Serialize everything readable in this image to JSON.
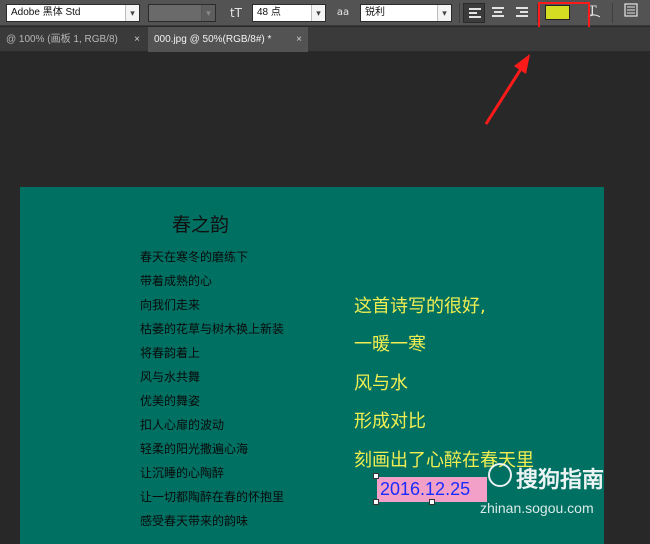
{
  "toolbar": {
    "font_family": "Adobe 黑体 Std",
    "font_style": "",
    "font_size_icon": "tT",
    "font_size": "48 点",
    "antialias_icon": "aa",
    "antialias": "锐利",
    "color_swatch": "#d4dd22",
    "warp_icon": "warp-text-icon",
    "panel_icon": "character-panel-icon"
  },
  "tabs": [
    {
      "label": "@ 100% (画板 1, RGB/8)",
      "close": "×"
    },
    {
      "label": "000.jpg @ 50%(RGB/8#) *",
      "close": "×"
    }
  ],
  "canvas": {
    "background": "#007062",
    "poem_title": "春之韵",
    "poem_lines": [
      "春天在寒冬的磨练下",
      "带着成熟的心",
      "向我们走来",
      "枯萎的花草与树木换上新装",
      "将春韵着上",
      "风与水共舞",
      "优美的舞姿",
      "扣人心扉的波动",
      "轻柔的阳光撒遍心海",
      "让沉睡的心陶醉",
      "让一切都陶醉在春的怀抱里",
      "感受春天带来的韵味"
    ],
    "comment_lines": [
      "这首诗写的很好,",
      "一暖一寒",
      "风与水",
      "形成对比",
      "刻画出了心醉在春天里"
    ],
    "date": "2016.12.25"
  },
  "watermark": {
    "text": "搜狗指南",
    "url": "zhinan.sogou.com"
  },
  "colors": {
    "annotation": "#ff1a1a",
    "comment_text": "#f1ee52",
    "date_highlight": "#f2a0c8",
    "date_text": "#1a2cff"
  }
}
